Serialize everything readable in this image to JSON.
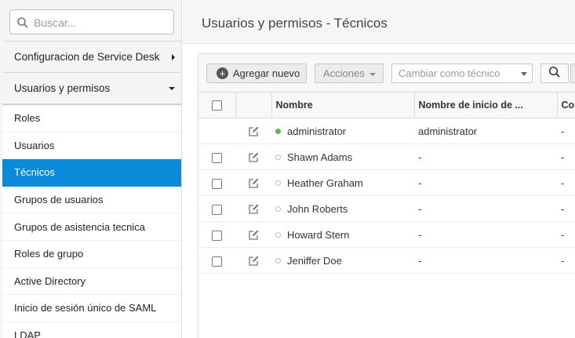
{
  "sidebar": {
    "search_placeholder": "Buscar...",
    "groups": [
      {
        "label": "Configuracion de Service Desk"
      },
      {
        "label": "Usuarios y permisos"
      }
    ],
    "items": [
      {
        "label": "Roles"
      },
      {
        "label": "Usuarios"
      },
      {
        "label": "Técnicos"
      },
      {
        "label": "Grupos de usuarios"
      },
      {
        "label": "Grupos de asistencia tecnica"
      },
      {
        "label": "Roles de grupo"
      },
      {
        "label": "Active Directory"
      },
      {
        "label": "Inicio de sesión único de SAML"
      },
      {
        "label": "LDAP"
      }
    ],
    "active_item": "Técnicos"
  },
  "header": {
    "title": "Usuarios y permisos - Técnicos"
  },
  "toolbar": {
    "add_label": "Agregar nuevo",
    "actions_label": "Acciones",
    "change_placeholder": "Cambiar como técnico"
  },
  "table": {
    "columns": [
      "Nombre",
      "Nombre de inicio de ...",
      "Co"
    ],
    "rows": [
      {
        "name": "administrator",
        "login": "administrator",
        "c": "-",
        "online": true,
        "checkbox": false
      },
      {
        "name": "Shawn Adams",
        "login": "-",
        "c": "-",
        "online": false,
        "checkbox": true
      },
      {
        "name": "Heather Graham",
        "login": "-",
        "c": "-",
        "online": false,
        "checkbox": true
      },
      {
        "name": "John Roberts",
        "login": "-",
        "c": "-",
        "online": false,
        "checkbox": true
      },
      {
        "name": "Howard Stern",
        "login": "-",
        "c": "-",
        "online": false,
        "checkbox": true
      },
      {
        "name": "Jeniffer Doe",
        "login": "-",
        "c": "-",
        "online": false,
        "checkbox": true
      }
    ]
  },
  "colors": {
    "active": "#0a8ad8",
    "online": "#5cb85c"
  },
  "icons": [
    "search-icon",
    "caret-right-icon",
    "caret-down-icon",
    "plus-circle-icon",
    "edit-icon",
    "status-dot-icon"
  ]
}
